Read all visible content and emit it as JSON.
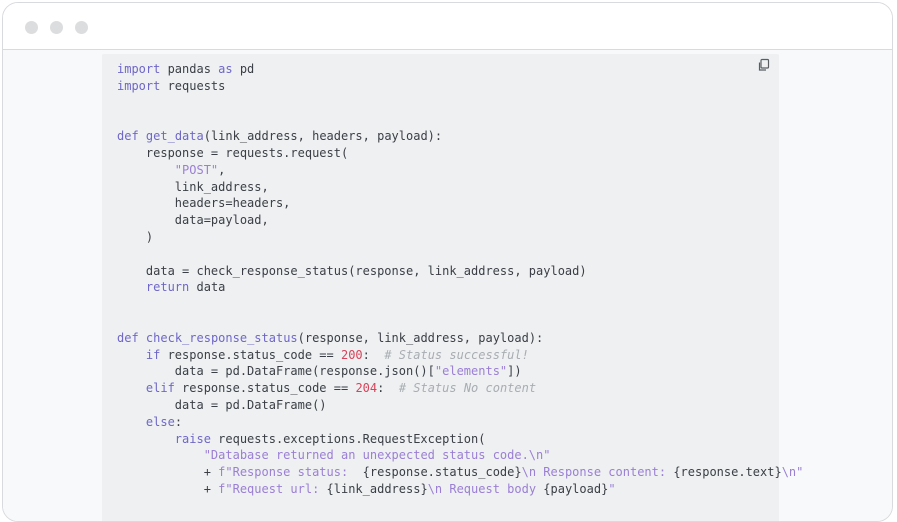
{
  "colors": {
    "keyword": "#6f67c7",
    "string": "#9b7fd4",
    "number": "#d6435a",
    "comment": "#a9adb2",
    "text": "#3b3f45",
    "code_background": "#eef0f2",
    "page_background": "#f7f9fb"
  },
  "window": {
    "controls": [
      "window-dot",
      "window-dot",
      "window-dot"
    ]
  },
  "code_block": {
    "copy_icon": "copy-icon",
    "language": "python",
    "lines": [
      [
        {
          "t": "kw",
          "v": "import"
        },
        {
          "t": "",
          "v": " pandas "
        },
        {
          "t": "kw",
          "v": "as"
        },
        {
          "t": "",
          "v": " pd"
        }
      ],
      [
        {
          "t": "kw",
          "v": "import"
        },
        {
          "t": "",
          "v": " requests"
        }
      ],
      [],
      [],
      [
        {
          "t": "kw",
          "v": "def"
        },
        {
          "t": "",
          "v": " "
        },
        {
          "t": "kw",
          "v": "get_data"
        },
        {
          "t": "",
          "v": "(link_address, headers, payload):"
        }
      ],
      [
        {
          "t": "",
          "v": "    response = requests.request("
        }
      ],
      [
        {
          "t": "",
          "v": "        "
        },
        {
          "t": "str",
          "v": "\"POST\""
        },
        {
          "t": "",
          "v": ","
        }
      ],
      [
        {
          "t": "",
          "v": "        link_address,"
        }
      ],
      [
        {
          "t": "",
          "v": "        headers=headers,"
        }
      ],
      [
        {
          "t": "",
          "v": "        data=payload,"
        }
      ],
      [
        {
          "t": "",
          "v": "    )"
        }
      ],
      [],
      [
        {
          "t": "",
          "v": "    data = check_response_status(response, link_address, payload)"
        }
      ],
      [
        {
          "t": "",
          "v": "    "
        },
        {
          "t": "kw",
          "v": "return"
        },
        {
          "t": "",
          "v": " data"
        }
      ],
      [],
      [],
      [
        {
          "t": "kw",
          "v": "def"
        },
        {
          "t": "",
          "v": " "
        },
        {
          "t": "kw",
          "v": "check_response_status"
        },
        {
          "t": "",
          "v": "(response, link_address, payload):"
        }
      ],
      [
        {
          "t": "",
          "v": "    "
        },
        {
          "t": "kw",
          "v": "if"
        },
        {
          "t": "",
          "v": " response.status_code == "
        },
        {
          "t": "num",
          "v": "200"
        },
        {
          "t": "",
          "v": ":  "
        },
        {
          "t": "com",
          "v": "# Status successful!"
        }
      ],
      [
        {
          "t": "",
          "v": "        data = pd.DataFrame(response.json()["
        },
        {
          "t": "str",
          "v": "\"elements\""
        },
        {
          "t": "",
          "v": "])"
        }
      ],
      [
        {
          "t": "",
          "v": "    "
        },
        {
          "t": "kw",
          "v": "elif"
        },
        {
          "t": "",
          "v": " response.status_code == "
        },
        {
          "t": "num",
          "v": "204"
        },
        {
          "t": "",
          "v": ":  "
        },
        {
          "t": "com",
          "v": "# Status No content"
        }
      ],
      [
        {
          "t": "",
          "v": "        data = pd.DataFrame()"
        }
      ],
      [
        {
          "t": "",
          "v": "    "
        },
        {
          "t": "kw",
          "v": "else"
        },
        {
          "t": "",
          "v": ":"
        }
      ],
      [
        {
          "t": "",
          "v": "        "
        },
        {
          "t": "kw",
          "v": "raise"
        },
        {
          "t": "",
          "v": " requests.exceptions.RequestException("
        }
      ],
      [
        {
          "t": "",
          "v": "            "
        },
        {
          "t": "str",
          "v": "\"Database returned an unexpected status code.\\n\""
        }
      ],
      [
        {
          "t": "",
          "v": "            + "
        },
        {
          "t": "str",
          "v": "f\"Response status:  "
        },
        {
          "t": "",
          "v": "{response.status_code}"
        },
        {
          "t": "str",
          "v": "\\n Response content: "
        },
        {
          "t": "",
          "v": "{response.text}"
        },
        {
          "t": "str",
          "v": "\\n\""
        }
      ],
      [
        {
          "t": "",
          "v": "            + "
        },
        {
          "t": "str",
          "v": "f\"Request url: "
        },
        {
          "t": "",
          "v": "{link_address}"
        },
        {
          "t": "str",
          "v": "\\n Request body "
        },
        {
          "t": "",
          "v": "{payload}"
        },
        {
          "t": "str",
          "v": "\""
        }
      ]
    ]
  }
}
